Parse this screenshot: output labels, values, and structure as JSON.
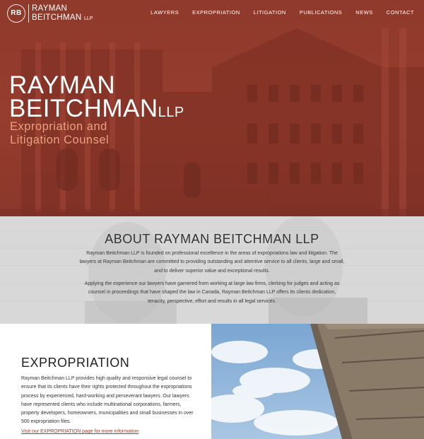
{
  "header": {
    "logo_initials": "RB",
    "logo_line1": "RAYMAN",
    "logo_line2": "BEITCHMAN",
    "logo_suffix": "LLP",
    "nav": [
      "LAWYERS",
      "EXPROPRIATION",
      "LITIGATION",
      "PUBLICATIONS",
      "NEWS",
      "CONTACT"
    ]
  },
  "hero": {
    "name_line1": "RAYMAN",
    "name_line2": "BEITCHMAN",
    "name_suffix": "LLP",
    "tagline_line1": "Expropriation and",
    "tagline_line2": "Litigation Counsel",
    "accent_color": "#e9a27f",
    "overlay_color": "#923c2d"
  },
  "about": {
    "title": "ABOUT RAYMAN BEITCHMAN LLP",
    "paragraph1": "Rayman Beitchman LLP is founded on professional excellence in the areas of expropriations law and litigation. The lawyers at Rayman Beitchman are committed to providing outstanding and attentive service to all clients, large and small, and to deliver superior value and exceptional results.",
    "paragraph2": "Applying the experience our lawyers have garnered from working at large law firms, clerking for judges and acting as counsel in proceedings that have shaped the law in Canada, Rayman Beitchman LLP offers its clients dedication, tenacity, perspective, effort and results in all legal services."
  },
  "expropriation": {
    "title": "EXPROPRIATION",
    "body": "Rayman Beitchman LLP provides high quality and responsive legal counsel to ensure that its clients have their rights protected throughout the expropriations process by experienced, hard-working and perseverant lawyers. Our lawyers have represented clients who include multinational corporations, farmers, property developers, homeowners, municipalities and small businesses in over 500 expropriation files.",
    "link": "Visit our EXPROPRIATION page for more information",
    "link_color": "#a23e27"
  }
}
